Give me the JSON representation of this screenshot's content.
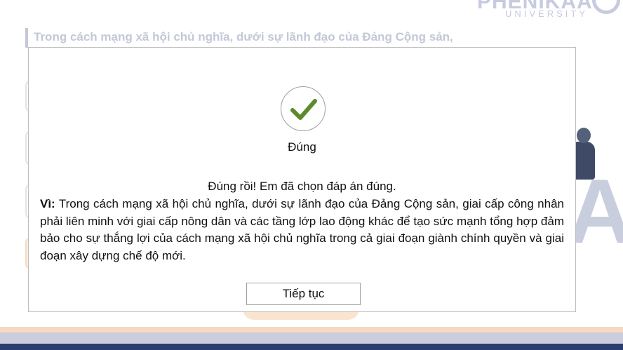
{
  "background": {
    "logo": {
      "brand": "PHENIKAA",
      "sub": "UNIVERSITY"
    },
    "question_text": "Trong cách mạng xã hội chủ nghĩa, dưới sự lãnh đạo của Đảng Cộng sản,"
  },
  "modal": {
    "icon": "check-icon",
    "title": "Đúng",
    "message": "Đúng rồi! Em đã chọn đáp án đúng.",
    "explanation_lead": "Vì:",
    "explanation_text": " Trong cách mạng xã hội chủ nghĩa, dưới sự lãnh đạo của Đảng Cộng sản, giai cấp công nhân phải liên minh với giai cấp nông dân và các tầng lớp lao động khác để tạo sức mạnh tổng hợp đảm bảo cho sự thắng lợi của cách mạng xã hội chủ nghĩa trong cả giai đoạn giành chính quyền và giai đoạn xây dựng chế độ mới.",
    "continue_label": "Tiếp tục"
  },
  "colors": {
    "check": "#5c8a2c",
    "accent_orange": "#fbe4cf",
    "footer_navy": "#2b3d6e"
  }
}
